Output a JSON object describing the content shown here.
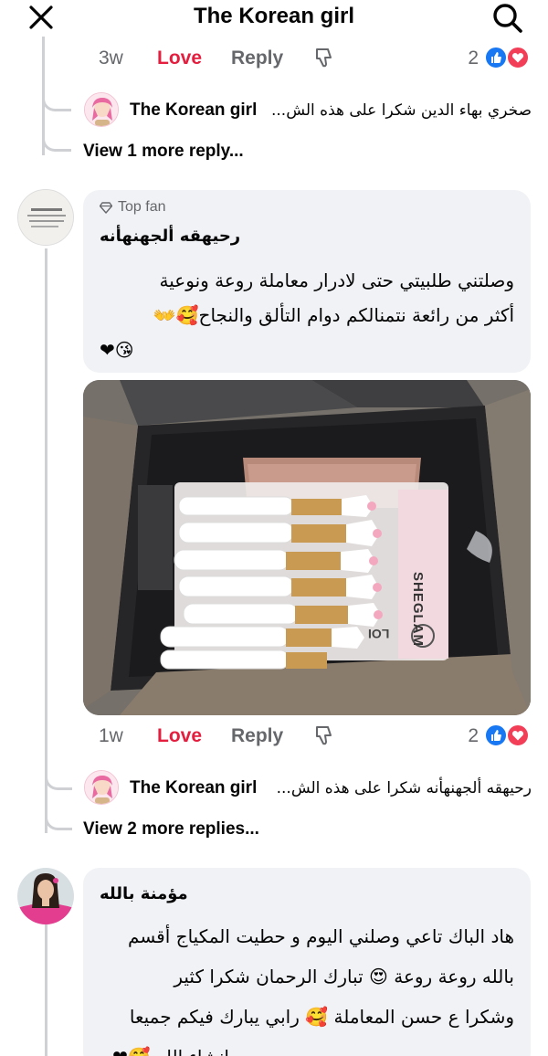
{
  "header": {
    "title": "The Korean girl",
    "close_icon": "close-icon",
    "search_icon": "search-icon"
  },
  "comment1_actions": {
    "time": "3w",
    "love": "Love",
    "reply": "Reply",
    "count": "2"
  },
  "comment1_reply": {
    "author": "The Korean girl",
    "text": "صخري بهاء الدين شكرا على هذه الش..."
  },
  "comment1_view_more": "View 1 more reply...",
  "comment2": {
    "badge": "Top fan",
    "author": "رحيهقه ألجهنهأنه",
    "lines": [
      "وصلتني طلبيتي حتى لادرار معاملة روعة ونوعية",
      "أكثر من رائعة نتمنالكم دوام التألق والنجاح🥰👐",
      "❤😘"
    ],
    "photo_label": "SHEGLAM",
    "photo_label2": "LOI",
    "time": "1w",
    "love": "Love",
    "reply": "Reply",
    "count": "2",
    "reply_preview": {
      "author": "The Korean girl",
      "text": "رحيهقه ألجهنهأنه شكرا على هذه الش..."
    },
    "view_more": "View 2 more replies..."
  },
  "comment3": {
    "author": "مؤمنة بالله",
    "lines": [
      "هاد الباك تاعي وصلني اليوم و حطيت المكياج أقسم",
      "بالله روعة روعة 😍 تبارك الرحمان شكرا كثير",
      "وشكرا ع حسن المعاملة 🥰 رابي يبارك فيكم جميعا",
      "انشاء الله 🥰❤"
    ]
  },
  "colors": {
    "love": "#e41e3f",
    "like": "#1877f2",
    "heart": "#f33e58",
    "bubble": "#f0f2f5",
    "muted": "#65676b"
  }
}
